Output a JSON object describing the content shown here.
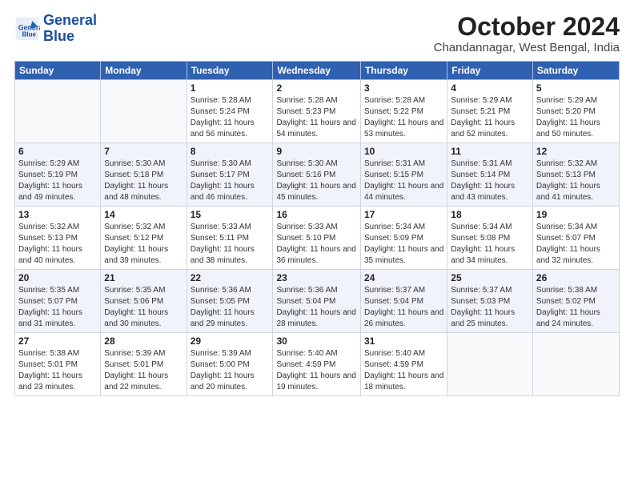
{
  "logo": {
    "line1": "General",
    "line2": "Blue"
  },
  "title": "October 2024",
  "location": "Chandannagar, West Bengal, India",
  "headers": [
    "Sunday",
    "Monday",
    "Tuesday",
    "Wednesday",
    "Thursday",
    "Friday",
    "Saturday"
  ],
  "weeks": [
    [
      {
        "day": "",
        "info": ""
      },
      {
        "day": "",
        "info": ""
      },
      {
        "day": "1",
        "info": "Sunrise: 5:28 AM\nSunset: 5:24 PM\nDaylight: 11 hours and 56 minutes."
      },
      {
        "day": "2",
        "info": "Sunrise: 5:28 AM\nSunset: 5:23 PM\nDaylight: 11 hours and 54 minutes."
      },
      {
        "day": "3",
        "info": "Sunrise: 5:28 AM\nSunset: 5:22 PM\nDaylight: 11 hours and 53 minutes."
      },
      {
        "day": "4",
        "info": "Sunrise: 5:29 AM\nSunset: 5:21 PM\nDaylight: 11 hours and 52 minutes."
      },
      {
        "day": "5",
        "info": "Sunrise: 5:29 AM\nSunset: 5:20 PM\nDaylight: 11 hours and 50 minutes."
      }
    ],
    [
      {
        "day": "6",
        "info": "Sunrise: 5:29 AM\nSunset: 5:19 PM\nDaylight: 11 hours and 49 minutes."
      },
      {
        "day": "7",
        "info": "Sunrise: 5:30 AM\nSunset: 5:18 PM\nDaylight: 11 hours and 48 minutes."
      },
      {
        "day": "8",
        "info": "Sunrise: 5:30 AM\nSunset: 5:17 PM\nDaylight: 11 hours and 46 minutes."
      },
      {
        "day": "9",
        "info": "Sunrise: 5:30 AM\nSunset: 5:16 PM\nDaylight: 11 hours and 45 minutes."
      },
      {
        "day": "10",
        "info": "Sunrise: 5:31 AM\nSunset: 5:15 PM\nDaylight: 11 hours and 44 minutes."
      },
      {
        "day": "11",
        "info": "Sunrise: 5:31 AM\nSunset: 5:14 PM\nDaylight: 11 hours and 43 minutes."
      },
      {
        "day": "12",
        "info": "Sunrise: 5:32 AM\nSunset: 5:13 PM\nDaylight: 11 hours and 41 minutes."
      }
    ],
    [
      {
        "day": "13",
        "info": "Sunrise: 5:32 AM\nSunset: 5:13 PM\nDaylight: 11 hours and 40 minutes."
      },
      {
        "day": "14",
        "info": "Sunrise: 5:32 AM\nSunset: 5:12 PM\nDaylight: 11 hours and 39 minutes."
      },
      {
        "day": "15",
        "info": "Sunrise: 5:33 AM\nSunset: 5:11 PM\nDaylight: 11 hours and 38 minutes."
      },
      {
        "day": "16",
        "info": "Sunrise: 5:33 AM\nSunset: 5:10 PM\nDaylight: 11 hours and 36 minutes."
      },
      {
        "day": "17",
        "info": "Sunrise: 5:34 AM\nSunset: 5:09 PM\nDaylight: 11 hours and 35 minutes."
      },
      {
        "day": "18",
        "info": "Sunrise: 5:34 AM\nSunset: 5:08 PM\nDaylight: 11 hours and 34 minutes."
      },
      {
        "day": "19",
        "info": "Sunrise: 5:34 AM\nSunset: 5:07 PM\nDaylight: 11 hours and 32 minutes."
      }
    ],
    [
      {
        "day": "20",
        "info": "Sunrise: 5:35 AM\nSunset: 5:07 PM\nDaylight: 11 hours and 31 minutes."
      },
      {
        "day": "21",
        "info": "Sunrise: 5:35 AM\nSunset: 5:06 PM\nDaylight: 11 hours and 30 minutes."
      },
      {
        "day": "22",
        "info": "Sunrise: 5:36 AM\nSunset: 5:05 PM\nDaylight: 11 hours and 29 minutes."
      },
      {
        "day": "23",
        "info": "Sunrise: 5:36 AM\nSunset: 5:04 PM\nDaylight: 11 hours and 28 minutes."
      },
      {
        "day": "24",
        "info": "Sunrise: 5:37 AM\nSunset: 5:04 PM\nDaylight: 11 hours and 26 minutes."
      },
      {
        "day": "25",
        "info": "Sunrise: 5:37 AM\nSunset: 5:03 PM\nDaylight: 11 hours and 25 minutes."
      },
      {
        "day": "26",
        "info": "Sunrise: 5:38 AM\nSunset: 5:02 PM\nDaylight: 11 hours and 24 minutes."
      }
    ],
    [
      {
        "day": "27",
        "info": "Sunrise: 5:38 AM\nSunset: 5:01 PM\nDaylight: 11 hours and 23 minutes."
      },
      {
        "day": "28",
        "info": "Sunrise: 5:39 AM\nSunset: 5:01 PM\nDaylight: 11 hours and 22 minutes."
      },
      {
        "day": "29",
        "info": "Sunrise: 5:39 AM\nSunset: 5:00 PM\nDaylight: 11 hours and 20 minutes."
      },
      {
        "day": "30",
        "info": "Sunrise: 5:40 AM\nSunset: 4:59 PM\nDaylight: 11 hours and 19 minutes."
      },
      {
        "day": "31",
        "info": "Sunrise: 5:40 AM\nSunset: 4:59 PM\nDaylight: 11 hours and 18 minutes."
      },
      {
        "day": "",
        "info": ""
      },
      {
        "day": "",
        "info": ""
      }
    ]
  ]
}
